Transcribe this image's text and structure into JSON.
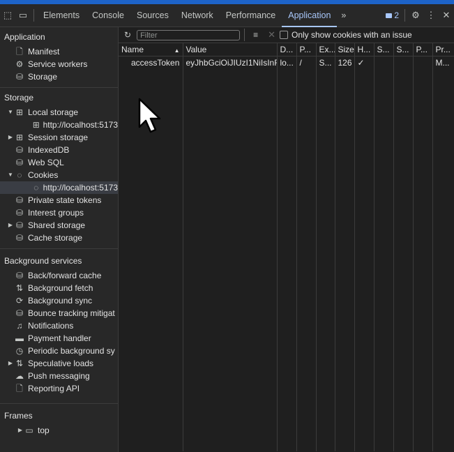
{
  "tabs": {
    "items": [
      "Elements",
      "Console",
      "Sources",
      "Network",
      "Performance",
      "Application"
    ],
    "more": "»",
    "issues_count": "2"
  },
  "sidebar": {
    "application": {
      "title": "Application",
      "items": [
        {
          "label": "Manifest",
          "icon": "document-icon"
        },
        {
          "label": "Service workers",
          "icon": "gears-icon"
        },
        {
          "label": "Storage",
          "icon": "database-icon"
        }
      ]
    },
    "storage": {
      "title": "Storage",
      "local_storage": "Local storage",
      "local_storage_child": "http://localhost:5173",
      "session_storage": "Session storage",
      "indexeddb": "IndexedDB",
      "websql": "Web SQL",
      "cookies": "Cookies",
      "cookies_child": "http://localhost:5173",
      "private_state_tokens": "Private state tokens",
      "interest_groups": "Interest groups",
      "shared_storage": "Shared storage",
      "cache_storage": "Cache storage"
    },
    "background": {
      "title": "Background services",
      "items": [
        "Back/forward cache",
        "Background fetch",
        "Background sync",
        "Bounce tracking mitigat",
        "Notifications",
        "Payment handler",
        "Periodic background sy",
        "Speculative loads",
        "Push messaging",
        "Reporting API"
      ]
    },
    "frames": {
      "title": "Frames",
      "top": "top"
    }
  },
  "toolbar": {
    "filter_placeholder": "Filter",
    "only_issue_label": "Only show cookies with an issue"
  },
  "table": {
    "columns": [
      "Name",
      "Value",
      "D...",
      "P...",
      "Ex...",
      "Size",
      "H...",
      "S...",
      "S...",
      "P...",
      "Pr..."
    ],
    "row": [
      "accessToken",
      "eyJhbGciOiJIUzI1NiIsInR...",
      "lo...",
      "/",
      "S...",
      "126",
      "✓",
      "",
      "",
      "",
      "M..."
    ]
  }
}
